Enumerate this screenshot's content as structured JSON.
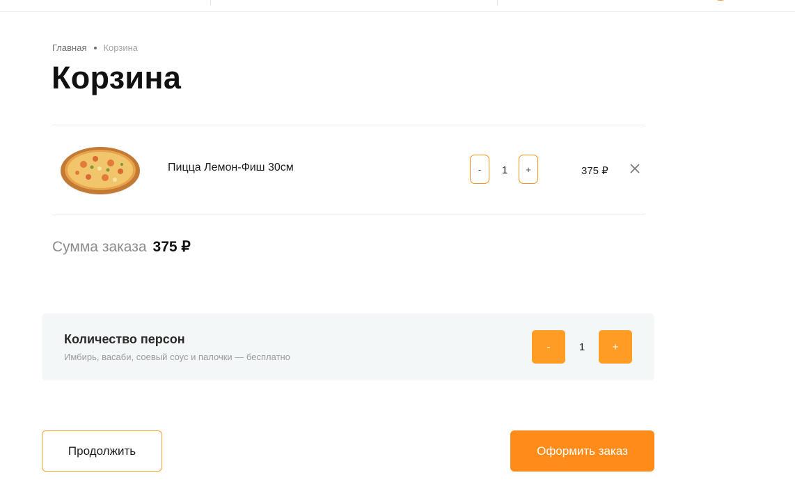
{
  "breadcrumb": {
    "home": "Главная",
    "current": "Корзина"
  },
  "page_title": "Корзина",
  "cart_items": [
    {
      "name": "Пицца Лемон-Фиш 30см",
      "quantity": "1",
      "price": "375 ₽",
      "minus_label": "-",
      "plus_label": "+"
    }
  ],
  "summary": {
    "label": "Сумма заказа",
    "value": "375 ₽"
  },
  "persons": {
    "title": "Количество персон",
    "subtitle": "Имбирь, васаби, соевый соус и палочки — бесплатно",
    "count": "1",
    "minus_label": "-",
    "plus_label": "+"
  },
  "actions": {
    "continue_label": "Продолжить",
    "order_label": "Оформить заказ"
  },
  "colors": {
    "accent": "#ff8c1a",
    "accent_border": "#f7931e",
    "panel_bg": "#f4f7f7"
  },
  "icons": {
    "remove": "close-icon",
    "product_image": "pizza-image"
  }
}
